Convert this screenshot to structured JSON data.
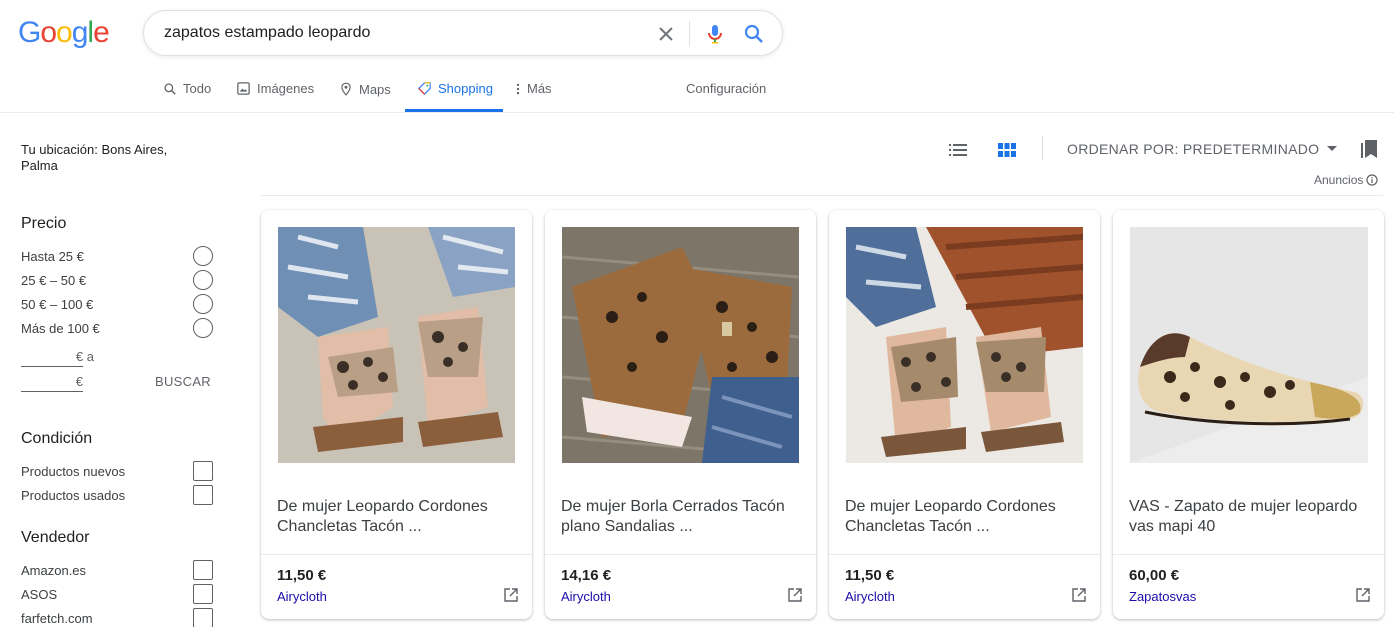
{
  "header": {
    "logo_letters": [
      {
        "char": "G",
        "color": "#4285F4"
      },
      {
        "char": "o",
        "color": "#EA4335"
      },
      {
        "char": "o",
        "color": "#FBBC05"
      },
      {
        "char": "g",
        "color": "#4285F4"
      },
      {
        "char": "l",
        "color": "#34A853"
      },
      {
        "char": "e",
        "color": "#EA4335"
      }
    ],
    "search": {
      "query": "zapatos estampado leopardo"
    }
  },
  "tabs": {
    "todo": "Todo",
    "imagenes": "Imágenes",
    "maps": "Maps",
    "shopping": "Shopping",
    "mas": "Más",
    "configuracion": "Configuración"
  },
  "sidebar": {
    "location": "Tu ubicación: Bons Aires, Palma",
    "price": {
      "title": "Precio",
      "options": [
        "Hasta 25 €",
        "25 € – 50 €",
        "50 € – 100 €",
        "Más de 100 €"
      ],
      "min_suffix": "€ a",
      "max_suffix": "€",
      "search_label": "BUSCAR"
    },
    "condition": {
      "title": "Condición",
      "options": [
        "Productos nuevos",
        "Productos usados"
      ]
    },
    "seller": {
      "title": "Vendedor",
      "options": [
        "Amazon.es",
        "ASOS",
        "farfetch.com"
      ]
    }
  },
  "toolbar": {
    "sort_label": "ORDENAR POR: PREDETERMINADO",
    "ads_label": "Anuncios"
  },
  "colors": {
    "accent": "#1a73e8",
    "seller_link": "#1a0dab"
  },
  "products": [
    {
      "title": "De mujer Leopardo Cordones Chancletas Tacón ...",
      "price": "11,50 €",
      "seller": "Airycloth"
    },
    {
      "title": "De mujer Borla Cerrados Tacón plano Sandalias ...",
      "price": "14,16 €",
      "seller": "Airycloth"
    },
    {
      "title": "De mujer Leopardo Cordones Chancletas Tacón ...",
      "price": "11,50 €",
      "seller": "Airycloth"
    },
    {
      "title": "VAS - Zapato de mujer leopardo vas mapi 40",
      "price": "60,00 €",
      "seller": "Zapatosvas"
    }
  ]
}
